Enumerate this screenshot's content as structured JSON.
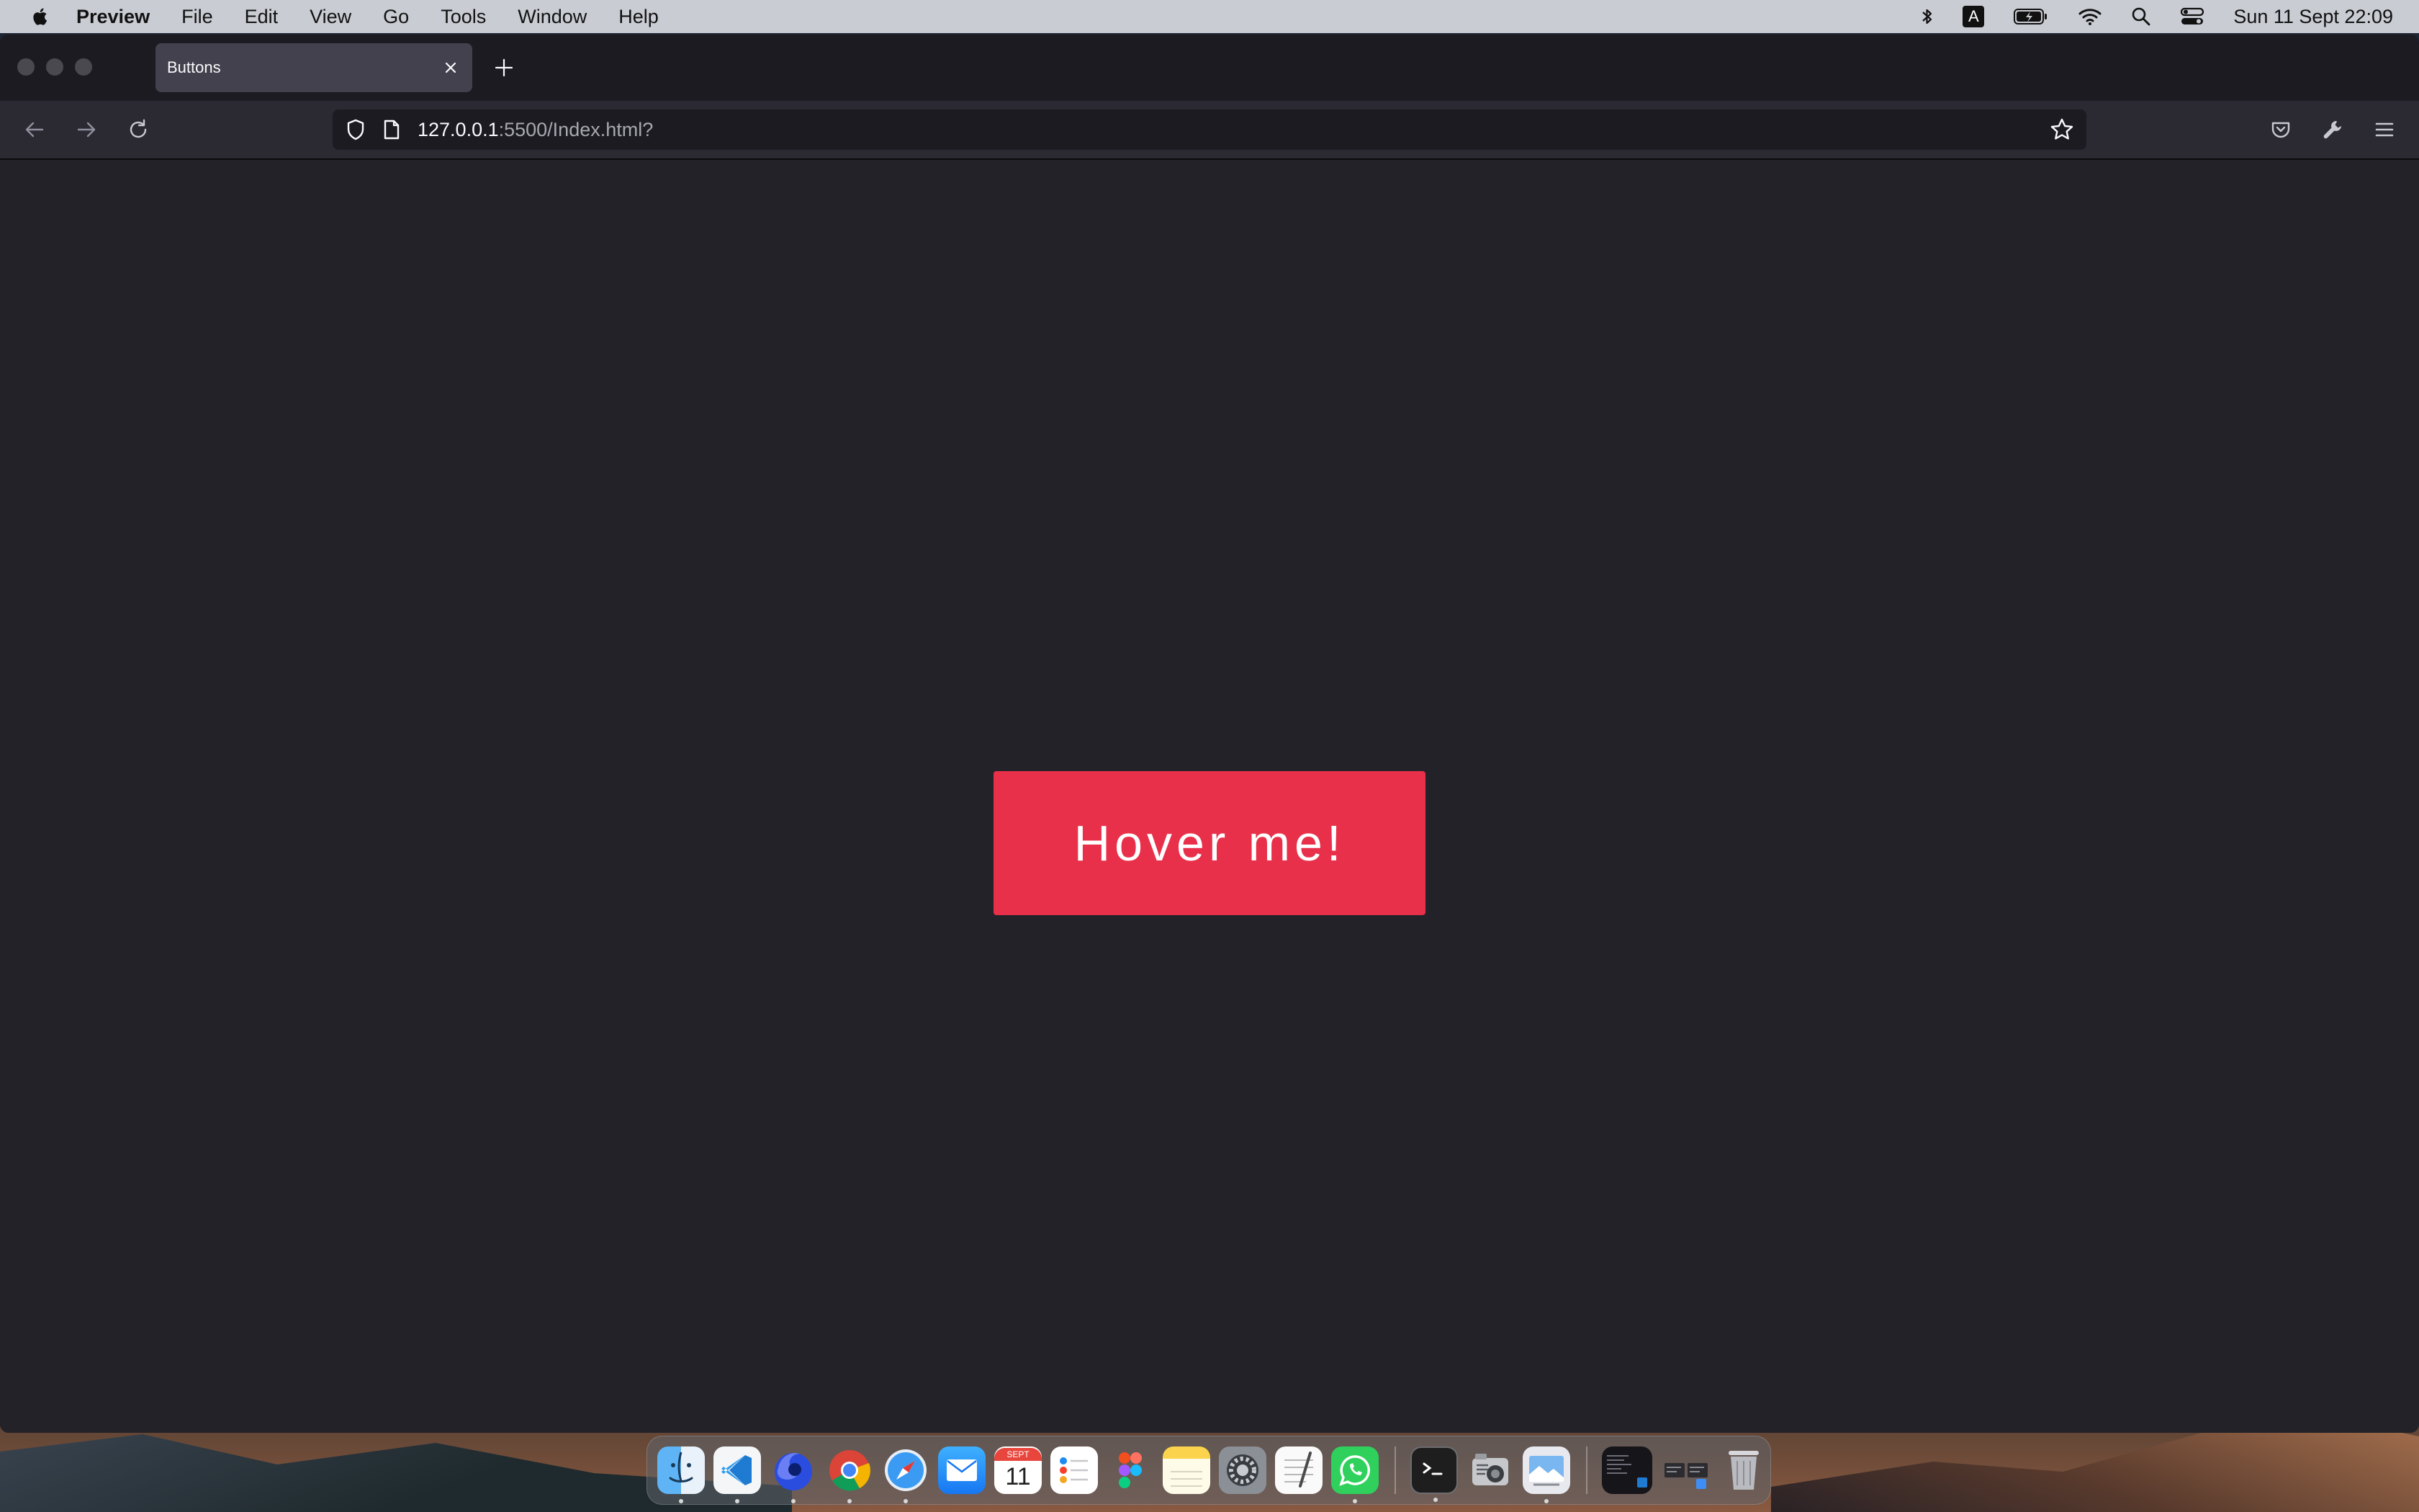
{
  "menubar": {
    "app_name": "Preview",
    "items": [
      "File",
      "Edit",
      "View",
      "Go",
      "Tools",
      "Window",
      "Help"
    ],
    "input_source": "A",
    "clock": "Sun 11 Sept  22:09"
  },
  "browser": {
    "tab_title": "Buttons",
    "url_host": "127.0.0.1",
    "url_rest": ":5500/Index.html?"
  },
  "page": {
    "button_label": "Hover me!",
    "button_color": "#e8304a",
    "background_color": "#232228"
  },
  "dock": {
    "calendar_month": "SEPT",
    "calendar_day": "11",
    "apps": [
      "finder-icon",
      "vscode-icon",
      "firefox-icon",
      "chrome-icon",
      "safari-icon",
      "mail-icon",
      "calendar-icon",
      "reminders-icon",
      "figma-icon",
      "notes-icon",
      "system-preferences-icon",
      "textedit-icon",
      "whatsapp-icon",
      "terminal-icon",
      "screenshot-app-icon",
      "preview-icon",
      "trash-icon"
    ]
  }
}
